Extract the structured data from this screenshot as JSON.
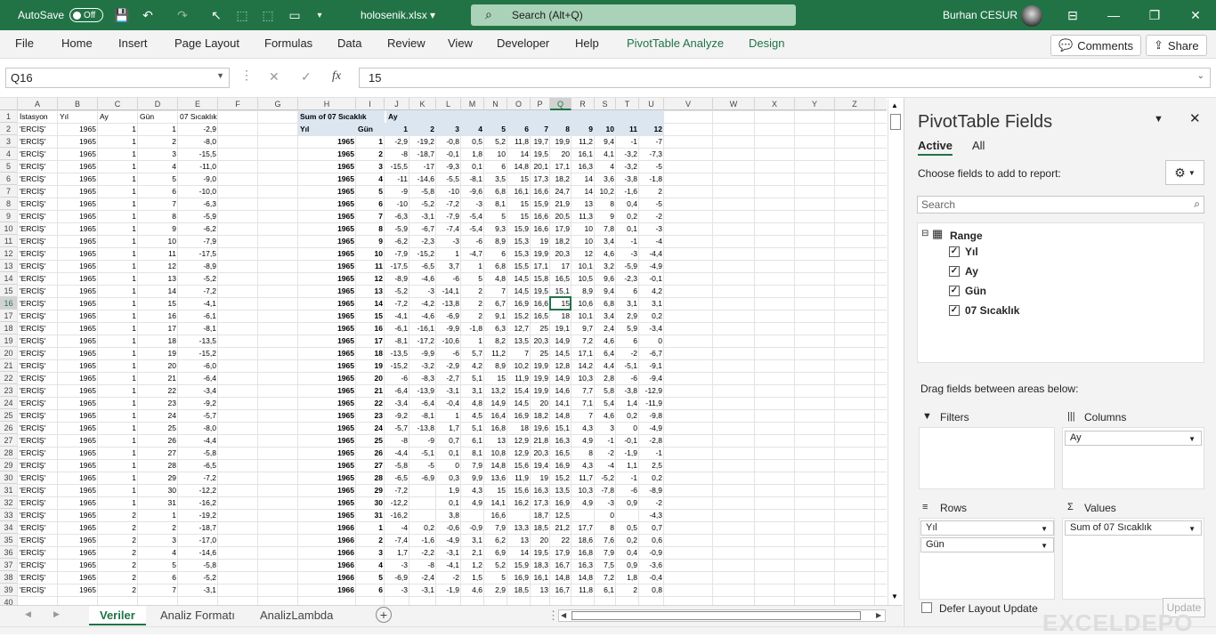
{
  "titlebar": {
    "autosave": "AutoSave",
    "autosave_state": "Off",
    "filename": "holosenik.xlsx",
    "search": "Search (Alt+Q)",
    "user": "Burhan CESUR"
  },
  "menu": [
    "File",
    "Home",
    "Insert",
    "Page Layout",
    "Formulas",
    "Data",
    "Review",
    "View",
    "Developer",
    "Help",
    "PivotTable Analyze",
    "Design"
  ],
  "ribbon_buttons": {
    "comments": "Comments",
    "share": "Share"
  },
  "formula_bar": {
    "name_box": "Q16",
    "fx": "fx",
    "value": "15"
  },
  "columns": [
    "A",
    "B",
    "C",
    "D",
    "E",
    "F",
    "G",
    "H",
    "I",
    "J",
    "K",
    "L",
    "M",
    "N",
    "O",
    "P",
    "Q",
    "R",
    "S",
    "T",
    "U",
    "V",
    "W",
    "X",
    "Y",
    "Z"
  ],
  "selected_col": "Q",
  "selected_row": "16",
  "row_numbers": [
    "1",
    "2",
    "3",
    "4",
    "5",
    "6",
    "7",
    "8",
    "9",
    "10",
    "11",
    "12",
    "13",
    "14",
    "15",
    "16",
    "17",
    "18",
    "19",
    "20",
    "21",
    "22",
    "23",
    "24",
    "25",
    "26",
    "27",
    "28",
    "29",
    "30",
    "31",
    "32",
    "33",
    "34",
    "35",
    "36",
    "37",
    "38",
    "39",
    "40"
  ],
  "table_headers": [
    "İstasyon",
    "Yıl",
    "Ay",
    "Gün",
    "07 Sıcaklık"
  ],
  "table_rows": [
    [
      "'ERCİŞ'",
      "1965",
      "1",
      "1",
      "-2,9"
    ],
    [
      "'ERCİŞ'",
      "1965",
      "1",
      "2",
      "-8,0"
    ],
    [
      "'ERCİŞ'",
      "1965",
      "1",
      "3",
      "-15,5"
    ],
    [
      "'ERCİŞ'",
      "1965",
      "1",
      "4",
      "-11,0"
    ],
    [
      "'ERCİŞ'",
      "1965",
      "1",
      "5",
      "-9,0"
    ],
    [
      "'ERCİŞ'",
      "1965",
      "1",
      "6",
      "-10,0"
    ],
    [
      "'ERCİŞ'",
      "1965",
      "1",
      "7",
      "-6,3"
    ],
    [
      "'ERCİŞ'",
      "1965",
      "1",
      "8",
      "-5,9"
    ],
    [
      "'ERCİŞ'",
      "1965",
      "1",
      "9",
      "-6,2"
    ],
    [
      "'ERCİŞ'",
      "1965",
      "1",
      "10",
      "-7,9"
    ],
    [
      "'ERCİŞ'",
      "1965",
      "1",
      "11",
      "-17,5"
    ],
    [
      "'ERCİŞ'",
      "1965",
      "1",
      "12",
      "-8,9"
    ],
    [
      "'ERCİŞ'",
      "1965",
      "1",
      "13",
      "-5,2"
    ],
    [
      "'ERCİŞ'",
      "1965",
      "1",
      "14",
      "-7,2"
    ],
    [
      "'ERCİŞ'",
      "1965",
      "1",
      "15",
      "-4,1"
    ],
    [
      "'ERCİŞ'",
      "1965",
      "1",
      "16",
      "-6,1"
    ],
    [
      "'ERCİŞ'",
      "1965",
      "1",
      "17",
      "-8,1"
    ],
    [
      "'ERCİŞ'",
      "1965",
      "1",
      "18",
      "-13,5"
    ],
    [
      "'ERCİŞ'",
      "1965",
      "1",
      "19",
      "-15,2"
    ],
    [
      "'ERCİŞ'",
      "1965",
      "1",
      "20",
      "-6,0"
    ],
    [
      "'ERCİŞ'",
      "1965",
      "1",
      "21",
      "-6,4"
    ],
    [
      "'ERCİŞ'",
      "1965",
      "1",
      "22",
      "-3,4"
    ],
    [
      "'ERCİŞ'",
      "1965",
      "1",
      "23",
      "-9,2"
    ],
    [
      "'ERCİŞ'",
      "1965",
      "1",
      "24",
      "-5,7"
    ],
    [
      "'ERCİŞ'",
      "1965",
      "1",
      "25",
      "-8,0"
    ],
    [
      "'ERCİŞ'",
      "1965",
      "1",
      "26",
      "-4,4"
    ],
    [
      "'ERCİŞ'",
      "1965",
      "1",
      "27",
      "-5,8"
    ],
    [
      "'ERCİŞ'",
      "1965",
      "1",
      "28",
      "-6,5"
    ],
    [
      "'ERCİŞ'",
      "1965",
      "1",
      "29",
      "-7,2"
    ],
    [
      "'ERCİŞ'",
      "1965",
      "1",
      "30",
      "-12,2"
    ],
    [
      "'ERCİŞ'",
      "1965",
      "1",
      "31",
      "-16,2"
    ],
    [
      "'ERCİŞ'",
      "1965",
      "2",
      "1",
      "-19,2"
    ],
    [
      "'ERCİŞ'",
      "1965",
      "2",
      "2",
      "-18,7"
    ],
    [
      "'ERCİŞ'",
      "1965",
      "2",
      "3",
      "-17,0"
    ],
    [
      "'ERCİŞ'",
      "1965",
      "2",
      "4",
      "-14,6"
    ],
    [
      "'ERCİŞ'",
      "1965",
      "2",
      "5",
      "-5,8"
    ],
    [
      "'ERCİŞ'",
      "1965",
      "2",
      "6",
      "-5,2"
    ],
    [
      "'ERCİŞ'",
      "1965",
      "2",
      "7",
      "-3,1"
    ]
  ],
  "pivot": {
    "corner": "Sum of 07 Sıcaklık",
    "col_field": "Ay",
    "row_field1": "Yıl",
    "row_field2": "Gün",
    "months": [
      "1",
      "2",
      "3",
      "4",
      "5",
      "6",
      "7",
      "8",
      "9",
      "10",
      "11",
      "12"
    ],
    "rows": [
      [
        "1965",
        "1",
        "-2,9",
        "-19,2",
        "-0,8",
        "0,5",
        "5,2",
        "11,8",
        "19,7",
        "19,9",
        "11,2",
        "9,4",
        "-1",
        "-7"
      ],
      [
        "1965",
        "2",
        "-8",
        "-18,7",
        "-0,1",
        "1,8",
        "10",
        "14",
        "19,5",
        "20",
        "16,1",
        "4,1",
        "-3,2",
        "-7,3"
      ],
      [
        "1965",
        "3",
        "-15,5",
        "-17",
        "-9,3",
        "0,1",
        "6",
        "14,8",
        "20,1",
        "17,1",
        "16,3",
        "4",
        "-3,2",
        "-5"
      ],
      [
        "1965",
        "4",
        "-11",
        "-14,6",
        "-5,5",
        "-8,1",
        "3,5",
        "15",
        "17,3",
        "18,2",
        "14",
        "3,6",
        "-3,8",
        "-1,8"
      ],
      [
        "1965",
        "5",
        "-9",
        "-5,8",
        "-10",
        "-9,6",
        "6,8",
        "16,1",
        "16,6",
        "24,7",
        "14",
        "10,2",
        "-1,6",
        "2"
      ],
      [
        "1965",
        "6",
        "-10",
        "-5,2",
        "-7,2",
        "-3",
        "8,1",
        "15",
        "15,9",
        "21,9",
        "13",
        "8",
        "0,4",
        "-5"
      ],
      [
        "1965",
        "7",
        "-6,3",
        "-3,1",
        "-7,9",
        "-5,4",
        "5",
        "15",
        "16,6",
        "20,5",
        "11,3",
        "9",
        "0,2",
        "-2"
      ],
      [
        "1965",
        "8",
        "-5,9",
        "-6,7",
        "-7,4",
        "-5,4",
        "9,3",
        "15,9",
        "16,6",
        "17,9",
        "10",
        "7,8",
        "0,1",
        "-3"
      ],
      [
        "1965",
        "9",
        "-6,2",
        "-2,3",
        "-3",
        "-6",
        "8,9",
        "15,3",
        "19",
        "18,2",
        "10",
        "3,4",
        "-1",
        "-4"
      ],
      [
        "1965",
        "10",
        "-7,9",
        "-15,2",
        "1",
        "-4,7",
        "6",
        "15,3",
        "19,9",
        "20,3",
        "12",
        "4,6",
        "-3",
        "-4,4"
      ],
      [
        "1965",
        "11",
        "-17,5",
        "-6,5",
        "3,7",
        "1",
        "6,8",
        "15,5",
        "17,1",
        "17",
        "10,1",
        "3,2",
        "-5,9",
        "-4,9"
      ],
      [
        "1965",
        "12",
        "-8,9",
        "-4,6",
        "-6",
        "5",
        "4,8",
        "14,5",
        "15,8",
        "16,5",
        "10,5",
        "9,6",
        "-2,3",
        "-0,1"
      ],
      [
        "1965",
        "13",
        "-5,2",
        "-3",
        "-14,1",
        "2",
        "7",
        "14,5",
        "19,5",
        "15,1",
        "8,9",
        "9,4",
        "6",
        "4,2"
      ],
      [
        "1965",
        "14",
        "-7,2",
        "-4,2",
        "-13,8",
        "2",
        "6,7",
        "16,9",
        "16,6",
        "15",
        "10,6",
        "6,8",
        "3,1",
        "3,1"
      ],
      [
        "1965",
        "15",
        "-4,1",
        "-4,6",
        "-6,9",
        "2",
        "9,1",
        "15,2",
        "16,5",
        "18",
        "10,1",
        "3,4",
        "2,9",
        "0,2"
      ],
      [
        "1965",
        "16",
        "-6,1",
        "-16,1",
        "-9,9",
        "-1,8",
        "6,3",
        "12,7",
        "25",
        "19,1",
        "9,7",
        "2,4",
        "5,9",
        "-3,4"
      ],
      [
        "1965",
        "17",
        "-8,1",
        "-17,2",
        "-10,6",
        "1",
        "8,2",
        "13,5",
        "20,3",
        "14,9",
        "7,2",
        "4,6",
        "6",
        "0"
      ],
      [
        "1965",
        "18",
        "-13,5",
        "-9,9",
        "-6",
        "5,7",
        "11,2",
        "7",
        "25",
        "14,5",
        "17,1",
        "6,4",
        "-2",
        "-6,7"
      ],
      [
        "1965",
        "19",
        "-15,2",
        "-3,2",
        "-2,9",
        "4,2",
        "8,9",
        "10,2",
        "19,9",
        "12,8",
        "14,2",
        "4,4",
        "-5,1",
        "-9,1"
      ],
      [
        "1965",
        "20",
        "-6",
        "-8,3",
        "-2,7",
        "5,1",
        "15",
        "11,9",
        "19,9",
        "14,9",
        "10,3",
        "2,8",
        "-6",
        "-9,4"
      ],
      [
        "1965",
        "21",
        "-6,4",
        "-13,9",
        "-3,1",
        "3,1",
        "13,2",
        "15,4",
        "19,9",
        "14,6",
        "7,7",
        "5,8",
        "-3,8",
        "-12,9"
      ],
      [
        "1965",
        "22",
        "-3,4",
        "-6,4",
        "-0,4",
        "4,8",
        "14,9",
        "14,5",
        "20",
        "14,1",
        "7,1",
        "5,4",
        "1,4",
        "-11,9"
      ],
      [
        "1965",
        "23",
        "-9,2",
        "-8,1",
        "1",
        "4,5",
        "16,4",
        "16,9",
        "18,2",
        "14,8",
        "7",
        "4,6",
        "0,2",
        "-9,8"
      ],
      [
        "1965",
        "24",
        "-5,7",
        "-13,8",
        "1,7",
        "5,1",
        "16,8",
        "18",
        "19,6",
        "15,1",
        "4,3",
        "3",
        "0",
        "-4,9"
      ],
      [
        "1965",
        "25",
        "-8",
        "-9",
        "0,7",
        "6,1",
        "13",
        "12,9",
        "21,8",
        "16,3",
        "4,9",
        "-1",
        "-0,1",
        "-2,8"
      ],
      [
        "1965",
        "26",
        "-4,4",
        "-5,1",
        "0,1",
        "8,1",
        "10,8",
        "12,9",
        "20,3",
        "16,5",
        "8",
        "-2",
        "-1,9",
        "-1"
      ],
      [
        "1965",
        "27",
        "-5,8",
        "-5",
        "0",
        "7,9",
        "14,8",
        "15,6",
        "19,4",
        "16,9",
        "4,3",
        "-4",
        "1,1",
        "2,5"
      ],
      [
        "1965",
        "28",
        "-6,5",
        "-6,9",
        "0,3",
        "9,9",
        "13,6",
        "11,9",
        "19",
        "15,2",
        "11,7",
        "-5,2",
        "-1",
        "0,2"
      ],
      [
        "1965",
        "29",
        "-7,2",
        "",
        "1,9",
        "4,3",
        "15",
        "15,6",
        "16,3",
        "13,5",
        "10,3",
        "-7,8",
        "-6",
        "-8,9"
      ],
      [
        "1965",
        "30",
        "-12,2",
        "",
        "0,1",
        "4,9",
        "14,1",
        "16,2",
        "17,3",
        "16,9",
        "4,9",
        "-3",
        "0,9",
        "-2"
      ],
      [
        "1965",
        "31",
        "-16,2",
        "",
        "3,8",
        "",
        "16,6",
        "",
        "18,7",
        "12,5",
        "",
        "0",
        "",
        "-4,3"
      ],
      [
        "1966",
        "1",
        "-4",
        "0,2",
        "-0,6",
        "-0,9",
        "7,9",
        "13,3",
        "18,5",
        "21,2",
        "17,7",
        "8",
        "0,5",
        "0,7"
      ],
      [
        "1966",
        "2",
        "-7,4",
        "-1,6",
        "-4,9",
        "3,1",
        "6,2",
        "13",
        "20",
        "22",
        "18,6",
        "7,6",
        "0,2",
        "0,6"
      ],
      [
        "1966",
        "3",
        "1,7",
        "-2,2",
        "-3,1",
        "2,1",
        "6,9",
        "14",
        "19,5",
        "17,9",
        "16,8",
        "7,9",
        "0,4",
        "-0,9"
      ],
      [
        "1966",
        "4",
        "-3",
        "-8",
        "-4,1",
        "1,2",
        "5,2",
        "15,9",
        "18,3",
        "16,7",
        "16,3",
        "7,5",
        "0,9",
        "-3,6"
      ],
      [
        "1966",
        "5",
        "-6,9",
        "-2,4",
        "-2",
        "1,5",
        "5",
        "16,9",
        "16,1",
        "14,8",
        "14,8",
        "7,2",
        "1,8",
        "-0,4"
      ],
      [
        "1966",
        "6",
        "-3",
        "-3,1",
        "-1,9",
        "4,6",
        "2,9",
        "18,5",
        "13",
        "16,7",
        "11,8",
        "6,1",
        "2",
        "0,8"
      ]
    ]
  },
  "sheet_tabs": [
    "Veriler",
    "Analiz Formatı",
    "AnalizLambda"
  ],
  "active_tab": "Veriler",
  "pane": {
    "title": "PivotTable Fields",
    "tab_active": "Active",
    "tab_all": "All",
    "choose": "Choose fields to add to report:",
    "search_placeholder": "Search",
    "range": "Range",
    "fields": [
      "Yıl",
      "Ay",
      "Gün",
      "07 Sıcaklık"
    ],
    "drag": "Drag fields between areas below:",
    "filters": "Filters",
    "columns": "Columns",
    "rows": "Rows",
    "values": "Values",
    "columns_items": [
      "Ay"
    ],
    "rows_items": [
      "Yıl",
      "Gün"
    ],
    "values_items": [
      "Sum of 07 Sıcaklık"
    ],
    "defer": "Defer Layout Update",
    "update": "Update"
  },
  "watermark": "EXCELDEPO"
}
